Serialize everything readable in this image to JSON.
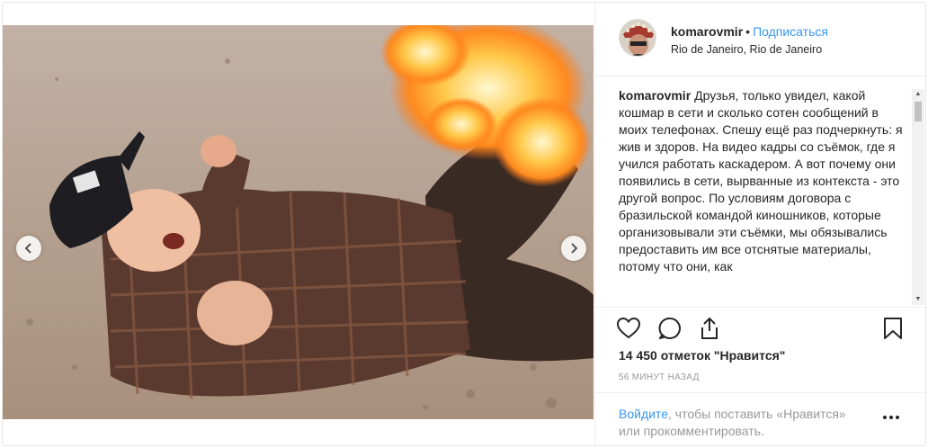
{
  "post": {
    "username": "komarovmir",
    "separator": "•",
    "follow_label": "Подписаться",
    "location": "Rio de Janeiro, Rio de Janeiro",
    "caption_user": "komarovmir",
    "caption_text": "Друзья, только увидел, какой кошмар в сети и сколько сотен сообщений в моих телефонах. Спешу ещё раз подчеркнуть: я жив и здоров. На видео кадры со съёмок, где я учился работать каскадером. А вот почему они появились в сети, вырванные из контекста - это другой вопрос. По условиям договора с бразильской командой киношников, которые организовывали эти съёмки, мы обязывались предоставить им все отснятые материалы, потому что они, как",
    "likes": "14 450 отметок \"Нравится\"",
    "time": "56 МИНУТ НАЗАД",
    "login_link": "Войдите",
    "login_rest": ", чтобы поставить «Нравится» или прокомментировать.",
    "carousel": {
      "total": 6,
      "active_index": 4
    },
    "icons": {
      "like": "heart-icon",
      "comment": "comment-icon",
      "share": "share-icon",
      "save": "bookmark-icon",
      "prev": "chevron-left-icon",
      "next": "chevron-right-icon",
      "more": "more-options-icon"
    },
    "colors": {
      "link": "#3897f0",
      "text": "#262626",
      "muted": "#999999"
    }
  }
}
